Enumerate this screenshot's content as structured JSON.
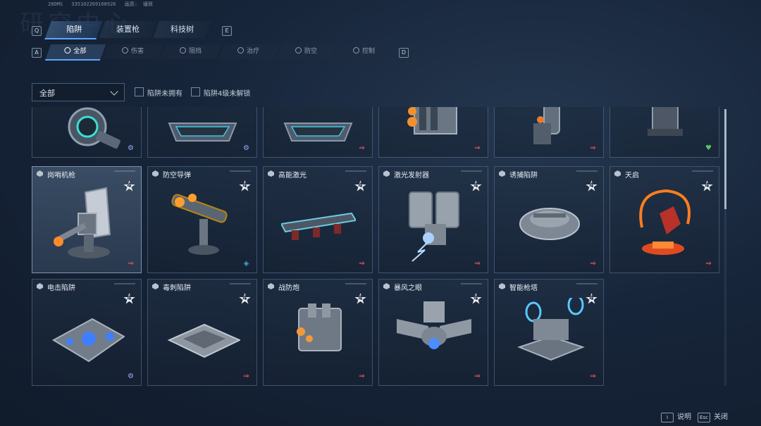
{
  "debug": {
    "latency": "28OMS",
    "id": "335102269168926",
    "quality_label": "画质:",
    "quality_value": "锤致"
  },
  "background_title": "研究中心",
  "tab_keys": {
    "prev": "Q",
    "next": "E"
  },
  "tabs": [
    {
      "label": "陷阱",
      "active": true
    },
    {
      "label": "装置枪",
      "active": false
    },
    {
      "label": "科技树",
      "active": false
    }
  ],
  "filter_keys": {
    "prev": "A",
    "next": "D"
  },
  "filters": [
    {
      "label": "全部",
      "icon": "all-icon",
      "active": true
    },
    {
      "label": "伤害",
      "icon": "damage-icon",
      "active": false
    },
    {
      "label": "阻挡",
      "icon": "block-icon",
      "active": false
    },
    {
      "label": "治疗",
      "icon": "heal-icon",
      "active": false
    },
    {
      "label": "防空",
      "icon": "anti-air-icon",
      "active": false
    },
    {
      "label": "控制",
      "icon": "control-icon",
      "active": false
    }
  ],
  "dropdown": {
    "value": "全部"
  },
  "checkboxes": [
    {
      "label": "陷阱未拥有",
      "checked": false
    },
    {
      "label": "陷阱4级未解锁",
      "checked": false
    }
  ],
  "rows": [
    [
      {
        "name": "",
        "corner": "gear-icon",
        "art": "disc"
      },
      {
        "name": "",
        "corner": "gear-icon",
        "art": "plate"
      },
      {
        "name": "",
        "corner": "arrow-icon",
        "art": "plate"
      },
      {
        "name": "",
        "corner": "arrow-icon",
        "art": "thruster"
      },
      {
        "name": "",
        "corner": "arrow-icon",
        "art": "cannon"
      },
      {
        "name": "",
        "corner": "heal-icon",
        "art": "tower"
      }
    ],
    [
      {
        "name": "岗哨机枪",
        "level": "4",
        "corner": "arrow-icon",
        "art": "turret",
        "selected": true
      },
      {
        "name": "防空导弹",
        "level": "4",
        "corner": "shield-icon",
        "art": "missile"
      },
      {
        "name": "高能激光",
        "level": "4",
        "corner": "arrow-icon",
        "art": "laser"
      },
      {
        "name": "激光发射器",
        "level": "4",
        "corner": "arrow-icon",
        "art": "emitter"
      },
      {
        "name": "诱捕陷阱",
        "level": "4",
        "corner": "arrow-icon",
        "art": "trap"
      },
      {
        "name": "天启",
        "level": "4",
        "corner": "arrow-icon",
        "art": "apocalypse"
      }
    ],
    [
      {
        "name": "电击陷阱",
        "level": "4",
        "corner": "gear-icon",
        "art": "shock"
      },
      {
        "name": "毒刺陷阱",
        "level": "4",
        "corner": "arrow-icon",
        "art": "spike"
      },
      {
        "name": "战防炮",
        "level": "4",
        "corner": "arrow-icon",
        "art": "flak"
      },
      {
        "name": "暴风之眼",
        "level": "4",
        "corner": "arrow-icon",
        "art": "eye"
      },
      {
        "name": "智能枪塔",
        "level": "4",
        "corner": "arrow-icon",
        "art": "smart"
      }
    ]
  ],
  "footer": [
    {
      "key": "I",
      "label": "说明"
    },
    {
      "key": "Esc",
      "label": "关闭"
    }
  ],
  "colors": {
    "accent": "#5aa6ff",
    "arrow": "#e0525c",
    "gear": "#9fa8ff",
    "heal": "#5dc06b",
    "shield": "#4aa3d1"
  }
}
